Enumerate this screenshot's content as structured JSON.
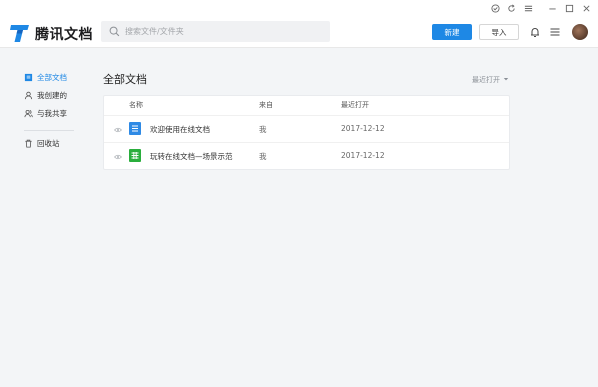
{
  "app": {
    "brand": "腾讯文档",
    "brand_color": "#1e88e5"
  },
  "search": {
    "placeholder": "搜索文件/文件夹"
  },
  "header": {
    "new_label": "新建",
    "import_label": "导入"
  },
  "sidebar": {
    "items": [
      {
        "label": "全部文档",
        "icon": "all-docs-icon",
        "active": true
      },
      {
        "label": "我创建的",
        "icon": "user-icon",
        "active": false
      },
      {
        "label": "与我共享",
        "icon": "shared-users-icon",
        "active": false
      },
      {
        "label": "回收站",
        "icon": "trash-icon",
        "active": false
      }
    ]
  },
  "main": {
    "title": "全部文档",
    "sort_label": "最近打开",
    "columns": {
      "name": "名称",
      "source": "来自",
      "last_opened": "最近打开"
    },
    "rows": [
      {
        "name": "欢迎使用在线文档",
        "source": "我",
        "date": "2017-12-12",
        "type": "doc",
        "color": "#2f8ae5"
      },
      {
        "name": "玩转在线文档—场景示范",
        "source": "我",
        "date": "2017-12-12",
        "type": "sheet",
        "color": "#2aae3d"
      }
    ]
  }
}
